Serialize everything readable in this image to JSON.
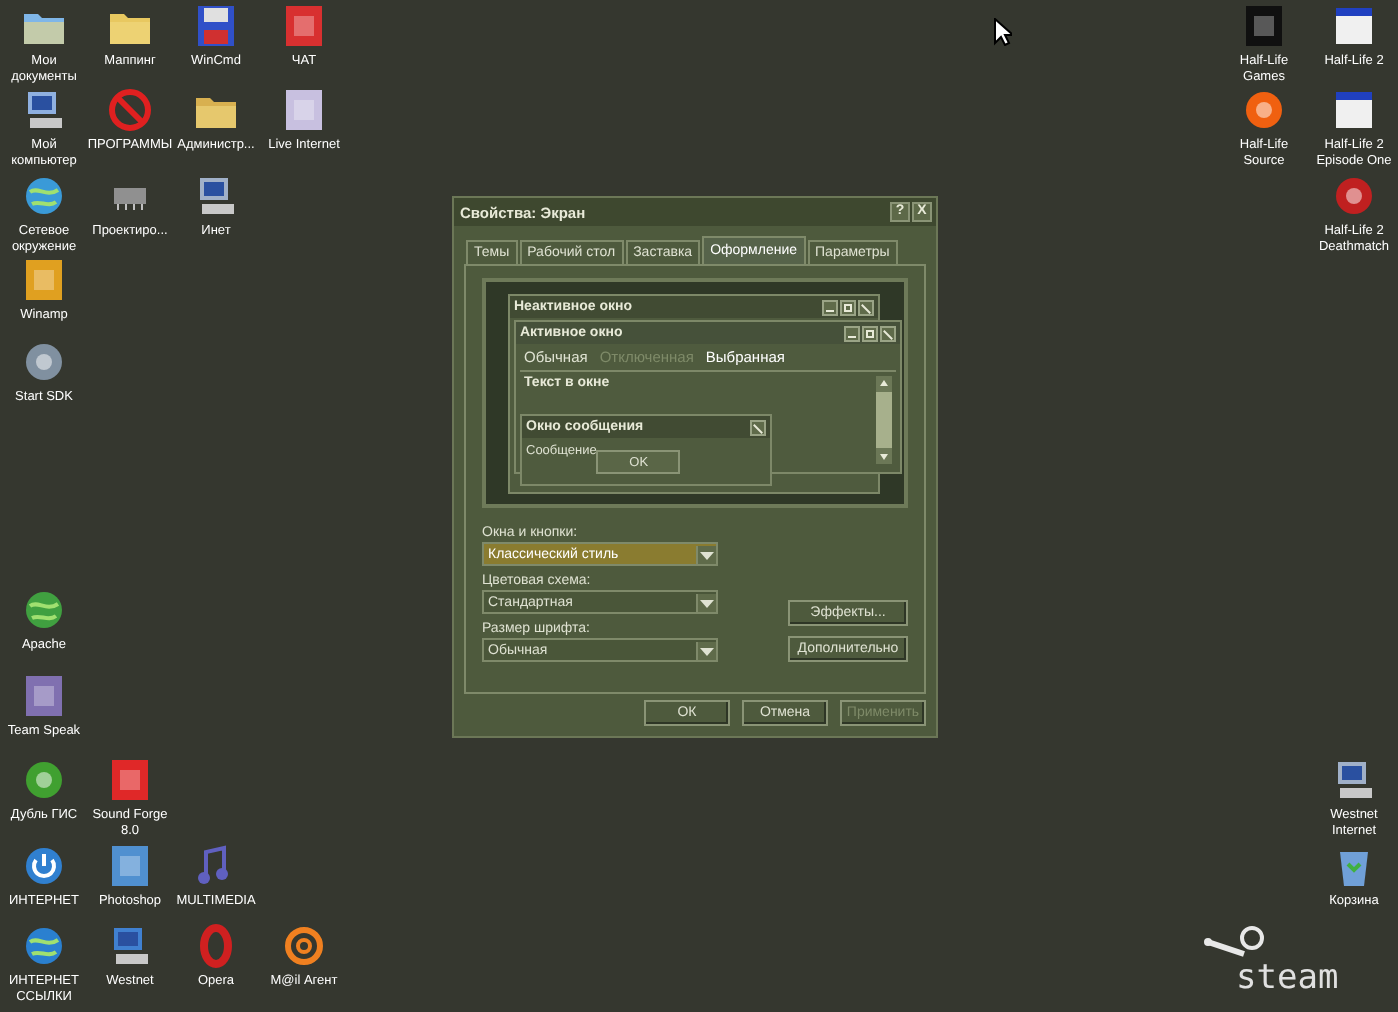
{
  "desktop": {
    "icons": [
      {
        "label": "Мои документы"
      },
      {
        "label": "Маппинг"
      },
      {
        "label": "WinCmd"
      },
      {
        "label": "ЧАТ"
      },
      {
        "label": "Мой компьютер"
      },
      {
        "label": "ПРОГРАММЫ"
      },
      {
        "label": "Администр..."
      },
      {
        "label": "Live Internet"
      },
      {
        "label": "Сетевое окружение"
      },
      {
        "label": "Проектиро..."
      },
      {
        "label": "Инет"
      },
      {
        "label": "Winamp"
      },
      {
        "label": "Start SDK"
      },
      {
        "label": "Apache"
      },
      {
        "label": "Team Speak"
      },
      {
        "label": "Дубль ГИС"
      },
      {
        "label": "Sound Forge 8.0"
      },
      {
        "label": "ИНТЕРНЕТ"
      },
      {
        "label": "Photoshop"
      },
      {
        "label": "MULTIMEDIA"
      },
      {
        "label": "ИНТЕРНЕТ ССЫЛКИ"
      },
      {
        "label": "Westnet"
      },
      {
        "label": "Opera"
      },
      {
        "label": "М@il Агент"
      },
      {
        "label": "Half-Life Games"
      },
      {
        "label": "Half-Life 2"
      },
      {
        "label": "Half-Life Source"
      },
      {
        "label": "Half-Life 2 Episode One"
      },
      {
        "label": "Half-Life 2 Deathmatch"
      },
      {
        "label": "Westnet Internet"
      },
      {
        "label": "Корзина"
      }
    ],
    "steam_logo": {
      "text": "steam"
    }
  },
  "dialog": {
    "title": "Свойства: Экран",
    "title_buttons": [
      "?",
      "X"
    ],
    "tabs": [
      {
        "label": "Темы",
        "selected": false
      },
      {
        "label": "Рабочий стол",
        "selected": false
      },
      {
        "label": "Заставка",
        "selected": false
      },
      {
        "label": "Оформление",
        "selected": true
      },
      {
        "label": "Параметры",
        "selected": false
      }
    ],
    "preview": {
      "inactive_window": {
        "title": "Неактивное окно"
      },
      "active_window": {
        "title": "Активное окно",
        "menu": [
          {
            "label": "Обычная",
            "disabled": false,
            "selected": false
          },
          {
            "label": "Отключенная",
            "disabled": true,
            "selected": false
          },
          {
            "label": "Выбранная",
            "disabled": false,
            "selected": true
          }
        ],
        "text": "Текст в окне"
      },
      "message_box": {
        "title": "Окно сообщения",
        "message": "Сообщение",
        "button": "OK"
      }
    },
    "fields": [
      {
        "label": "Окна и кнопки:",
        "value": "Классический стиль",
        "focused": true
      },
      {
        "label": "Цветовая схема:",
        "value": "Стандартная",
        "focused": false
      },
      {
        "label": "Размер шрифта:",
        "value": "Обычная",
        "focused": false
      }
    ],
    "side_buttons": [
      "Эффекты...",
      "Дополнительно"
    ],
    "buttons": [
      {
        "label": "ОК",
        "disabled": false
      },
      {
        "label": "Отмена",
        "disabled": false
      },
      {
        "label": "Применить",
        "disabled": true
      }
    ]
  }
}
